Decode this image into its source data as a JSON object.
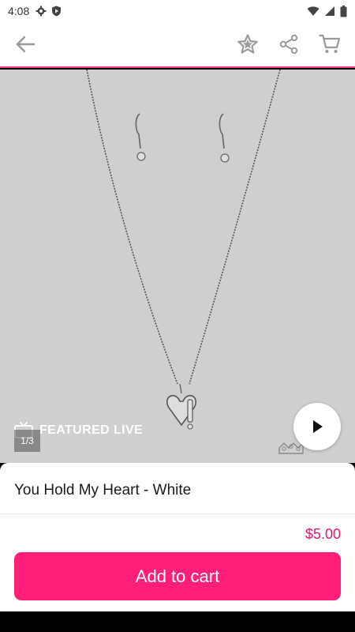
{
  "status_bar": {
    "time": "4:08"
  },
  "app_bar": {
    "icons": [
      "back-arrow-icon",
      "star-icon",
      "share-icon",
      "cart-icon"
    ]
  },
  "hero": {
    "featured_label": "FEATURED LIVE",
    "image_counter": "1/3"
  },
  "product": {
    "title": "You Hold My Heart - White",
    "price": "$5.00",
    "add_to_cart_label": "Add to cart"
  },
  "colors": {
    "accent": "#ff1f78",
    "price": "#e0176f",
    "hero_bg": "#cfcfcf"
  }
}
